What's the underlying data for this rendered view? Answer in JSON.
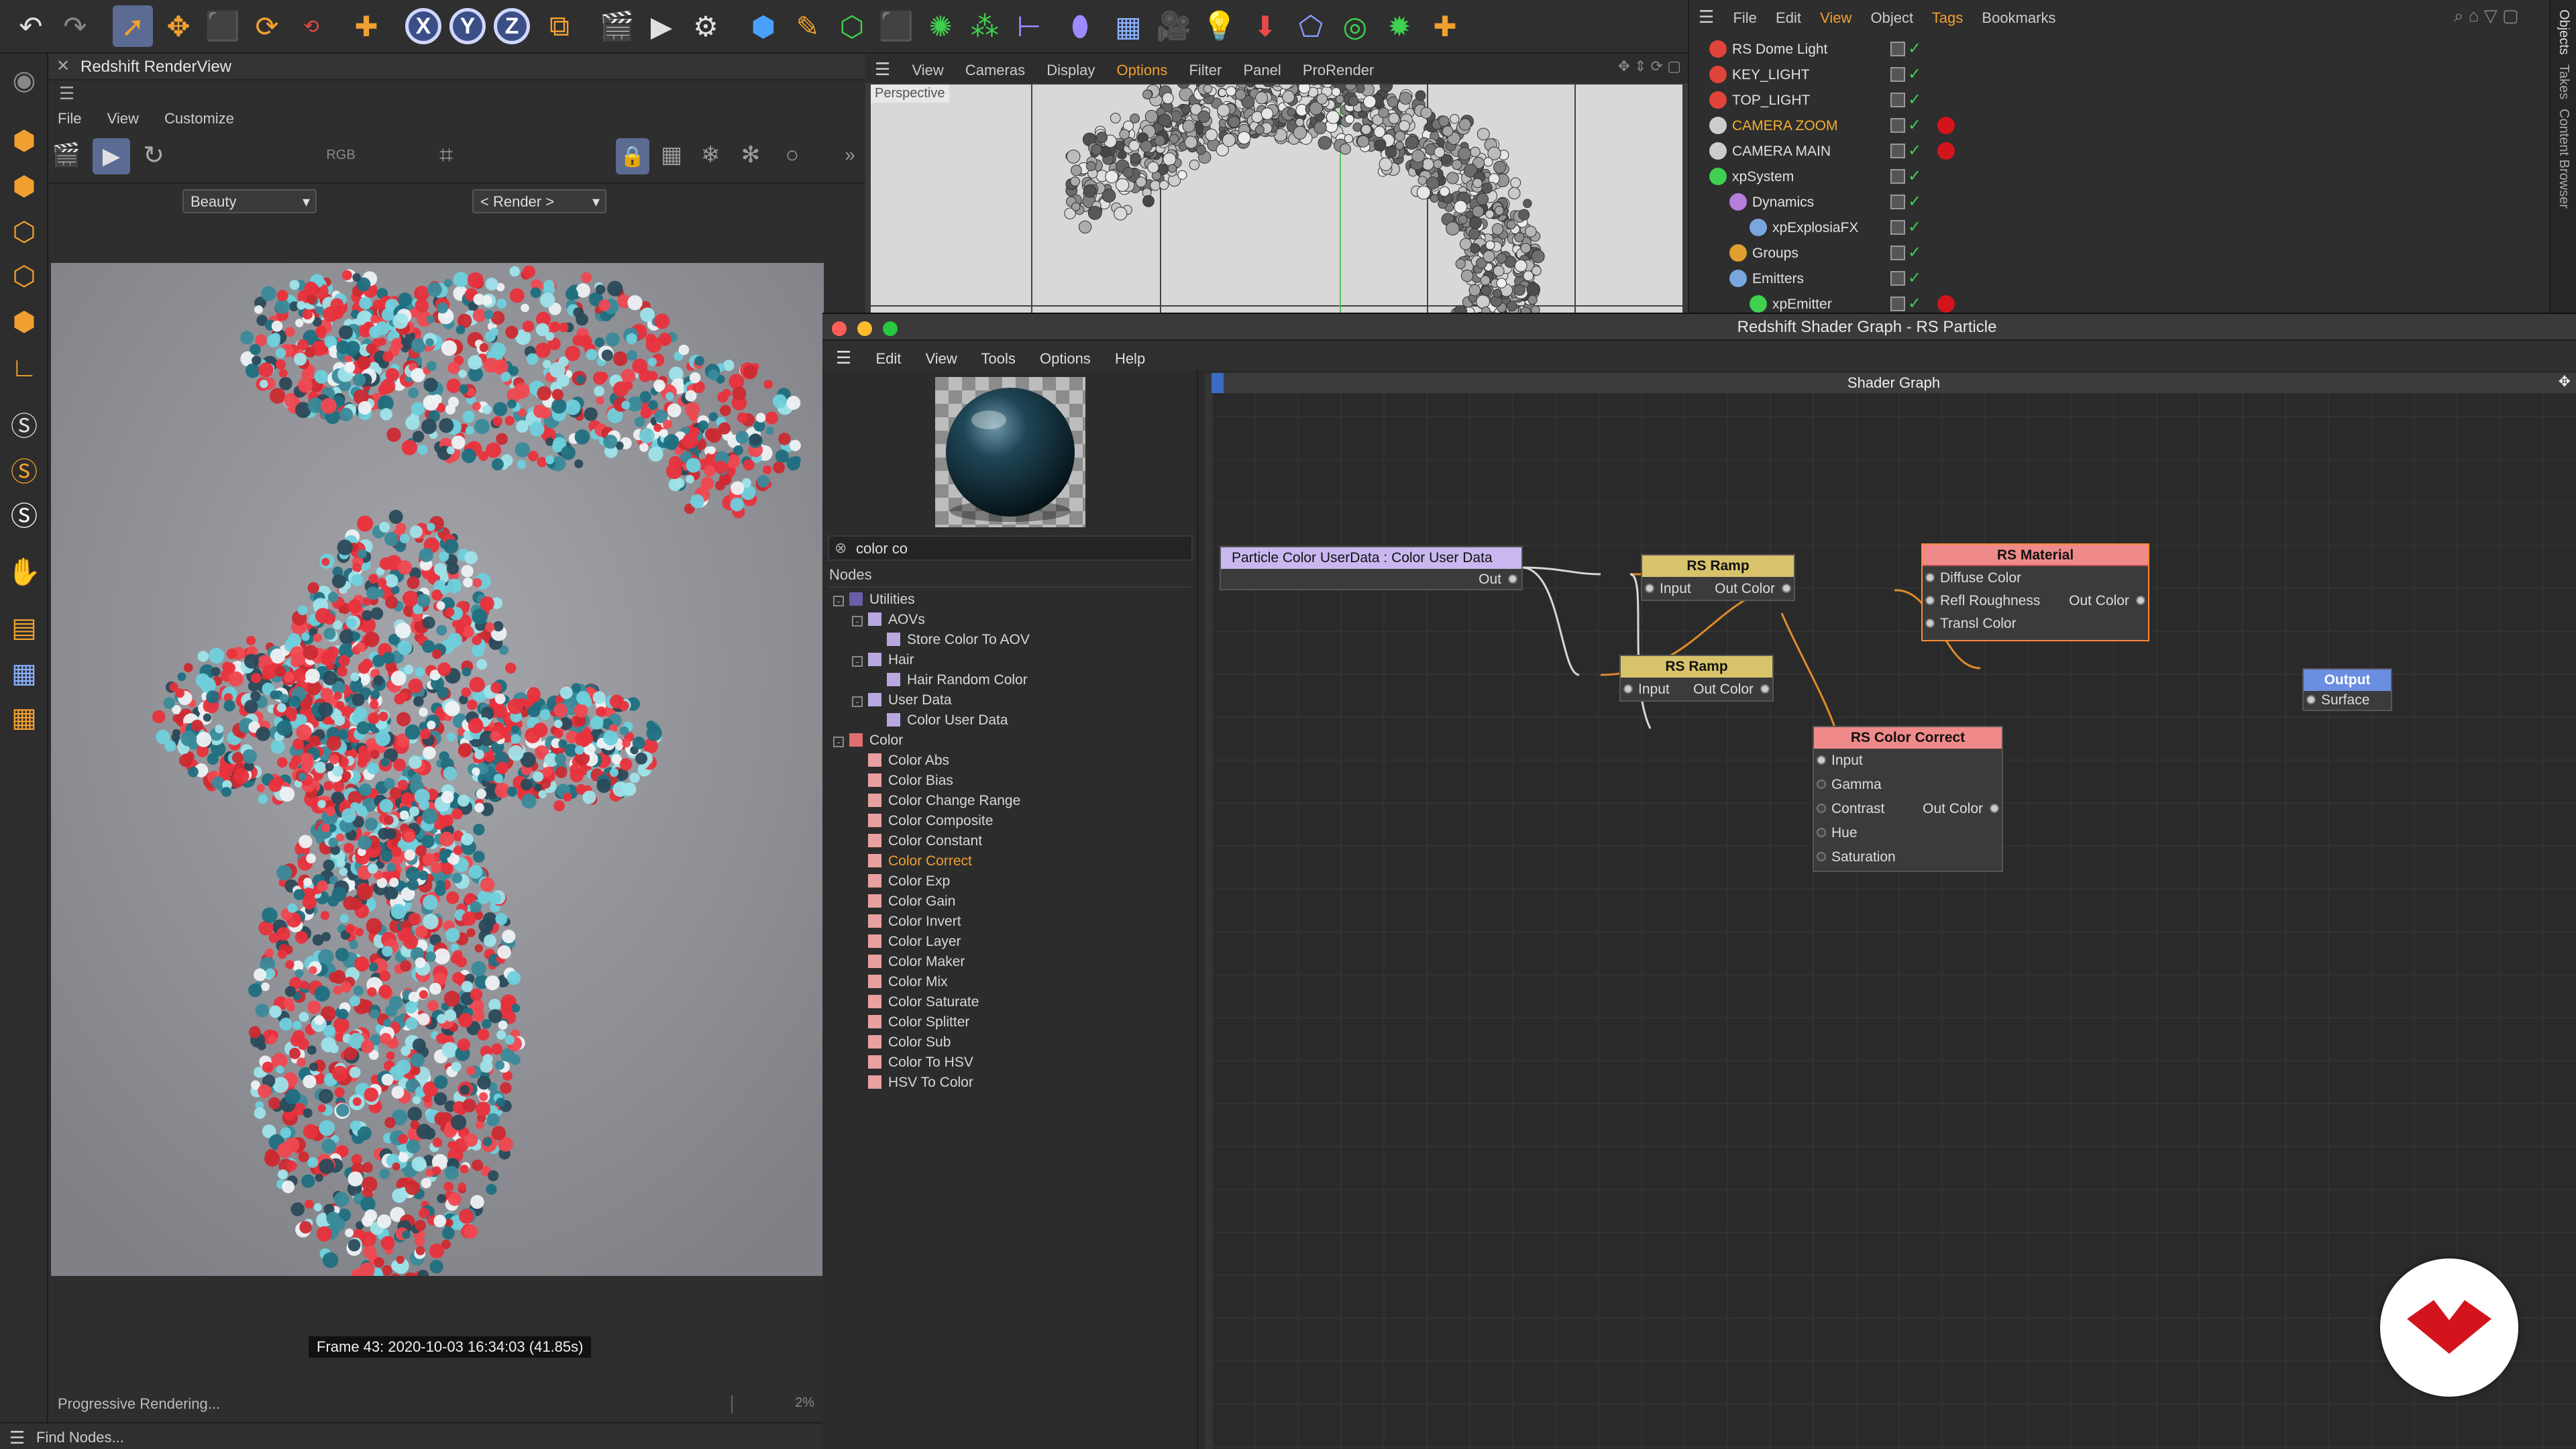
{
  "renderview": {
    "title": "Redshift RenderView",
    "menu": [
      "File",
      "View",
      "Customize"
    ],
    "aov_select": "Beauty",
    "render_select": "< Render >",
    "frame_info": "Frame 43:  2020-10-03  16:34:03  (41.85s)",
    "status": "Progressive Rendering...",
    "progress": "2%",
    "progress_value": 2
  },
  "viewport": {
    "menu": [
      "View",
      "Cameras",
      "Display",
      "Options",
      "Filter",
      "Panel",
      "ProRender"
    ],
    "active_menu": "Options",
    "perspective_label": "Perspective",
    "camera_label": "CAMERA ZOOM"
  },
  "objmgr": {
    "menu": [
      "File",
      "Edit",
      "View",
      "Object",
      "Tags",
      "Bookmarks"
    ],
    "active_menu": [
      "View",
      "Tags"
    ],
    "side_tabs": [
      "Objects",
      "Takes",
      "Content Browser"
    ],
    "rows": [
      {
        "name": "RS Dome Light",
        "indent": 0,
        "color": "#e0443a"
      },
      {
        "name": "KEY_LIGHT",
        "indent": 0,
        "color": "#e0443a"
      },
      {
        "name": "TOP_LIGHT",
        "indent": 0,
        "color": "#e0443a"
      },
      {
        "name": "CAMERA ZOOM",
        "indent": 0,
        "color": "#cccccc",
        "selected": true
      },
      {
        "name": "CAMERA MAIN",
        "indent": 0,
        "color": "#cccccc"
      },
      {
        "name": "xpSystem",
        "indent": 0,
        "color": "#3fd04f"
      },
      {
        "name": "Dynamics",
        "indent": 1,
        "color": "#b57edc"
      },
      {
        "name": "xpExplosiaFX",
        "indent": 2,
        "color": "#7aa6e0"
      },
      {
        "name": "Groups",
        "indent": 1,
        "color": "#e0a030"
      },
      {
        "name": "Emitters",
        "indent": 1,
        "color": "#7aa6e0"
      },
      {
        "name": "xpEmitter",
        "indent": 2,
        "color": "#3fd04f"
      }
    ]
  },
  "shader": {
    "title": "Redshift Shader Graph - RS Particle",
    "menu": [
      "Edit",
      "View",
      "Tools",
      "Options",
      "Help"
    ],
    "search_value": "color co",
    "nodes_header": "Nodes",
    "graph_title": "Shader Graph",
    "find_nodes": "Find Nodes...",
    "tree": [
      {
        "label": "Utilities",
        "level": 0,
        "color": "#6a5fa8",
        "expander": "-"
      },
      {
        "label": "AOVs",
        "level": 1,
        "color": "#b9a8e0",
        "expander": "-"
      },
      {
        "label": "Store Color To AOV",
        "level": 2,
        "color": "#b9a8e0"
      },
      {
        "label": "Hair",
        "level": 1,
        "color": "#b9a8e0",
        "expander": "-"
      },
      {
        "label": "Hair Random Color",
        "level": 2,
        "color": "#b9a8e0"
      },
      {
        "label": "User Data",
        "level": 1,
        "color": "#b9a8e0",
        "expander": "-"
      },
      {
        "label": "Color User Data",
        "level": 2,
        "color": "#b9a8e0"
      },
      {
        "label": "Color",
        "level": 0,
        "color": "#e07070",
        "expander": "-"
      },
      {
        "label": "Color Abs",
        "level": 1,
        "color": "#e8a0a0"
      },
      {
        "label": "Color Bias",
        "level": 1,
        "color": "#e8a0a0"
      },
      {
        "label": "Color Change Range",
        "level": 1,
        "color": "#e8a0a0"
      },
      {
        "label": "Color Composite",
        "level": 1,
        "color": "#e8a0a0"
      },
      {
        "label": "Color Constant",
        "level": 1,
        "color": "#e8a0a0"
      },
      {
        "label": "Color Correct",
        "level": 1,
        "color": "#e8a0a0",
        "highlight": true
      },
      {
        "label": "Color Exp",
        "level": 1,
        "color": "#e8a0a0"
      },
      {
        "label": "Color Gain",
        "level": 1,
        "color": "#e8a0a0"
      },
      {
        "label": "Color Invert",
        "level": 1,
        "color": "#e8a0a0"
      },
      {
        "label": "Color Layer",
        "level": 1,
        "color": "#e8a0a0"
      },
      {
        "label": "Color Maker",
        "level": 1,
        "color": "#e8a0a0"
      },
      {
        "label": "Color Mix",
        "level": 1,
        "color": "#e8a0a0"
      },
      {
        "label": "Color Saturate",
        "level": 1,
        "color": "#e8a0a0"
      },
      {
        "label": "Color Splitter",
        "level": 1,
        "color": "#e8a0a0"
      },
      {
        "label": "Color Sub",
        "level": 1,
        "color": "#e8a0a0"
      },
      {
        "label": "Color To HSV",
        "level": 1,
        "color": "#e8a0a0"
      },
      {
        "label": "HSV To Color",
        "level": 1,
        "color": "#e8a0a0"
      }
    ],
    "nodes": {
      "user_data": {
        "title": "Particle Color UserData : Color User Data",
        "out": "Out",
        "color": "#c9b8f0"
      },
      "ramp1": {
        "title": "RS Ramp",
        "in": "Input",
        "out": "Out Color",
        "color": "#d8c36a"
      },
      "ramp2": {
        "title": "RS Ramp",
        "in": "Input",
        "out": "Out Color",
        "color": "#d8c36a"
      },
      "material": {
        "title": "RS Material",
        "inputs": [
          "Diffuse Color",
          "Refl Roughness",
          "Transl Color"
        ],
        "out": "Out Color",
        "color": "#f08a8a"
      },
      "color_correct": {
        "title": "RS Color Correct",
        "inputs": [
          "Input",
          "Gamma",
          "Contrast",
          "Hue",
          "Saturation"
        ],
        "out": "Out Color",
        "color": "#f08a8a"
      },
      "output": {
        "title": "Output",
        "in": "Surface",
        "color": "#6a8ee0"
      }
    }
  },
  "colors": {
    "accent_orange": "#f0a030",
    "wire_white": "#d8d8d8",
    "wire_orange": "#e08a2a",
    "logo_red": "#d4141c"
  }
}
